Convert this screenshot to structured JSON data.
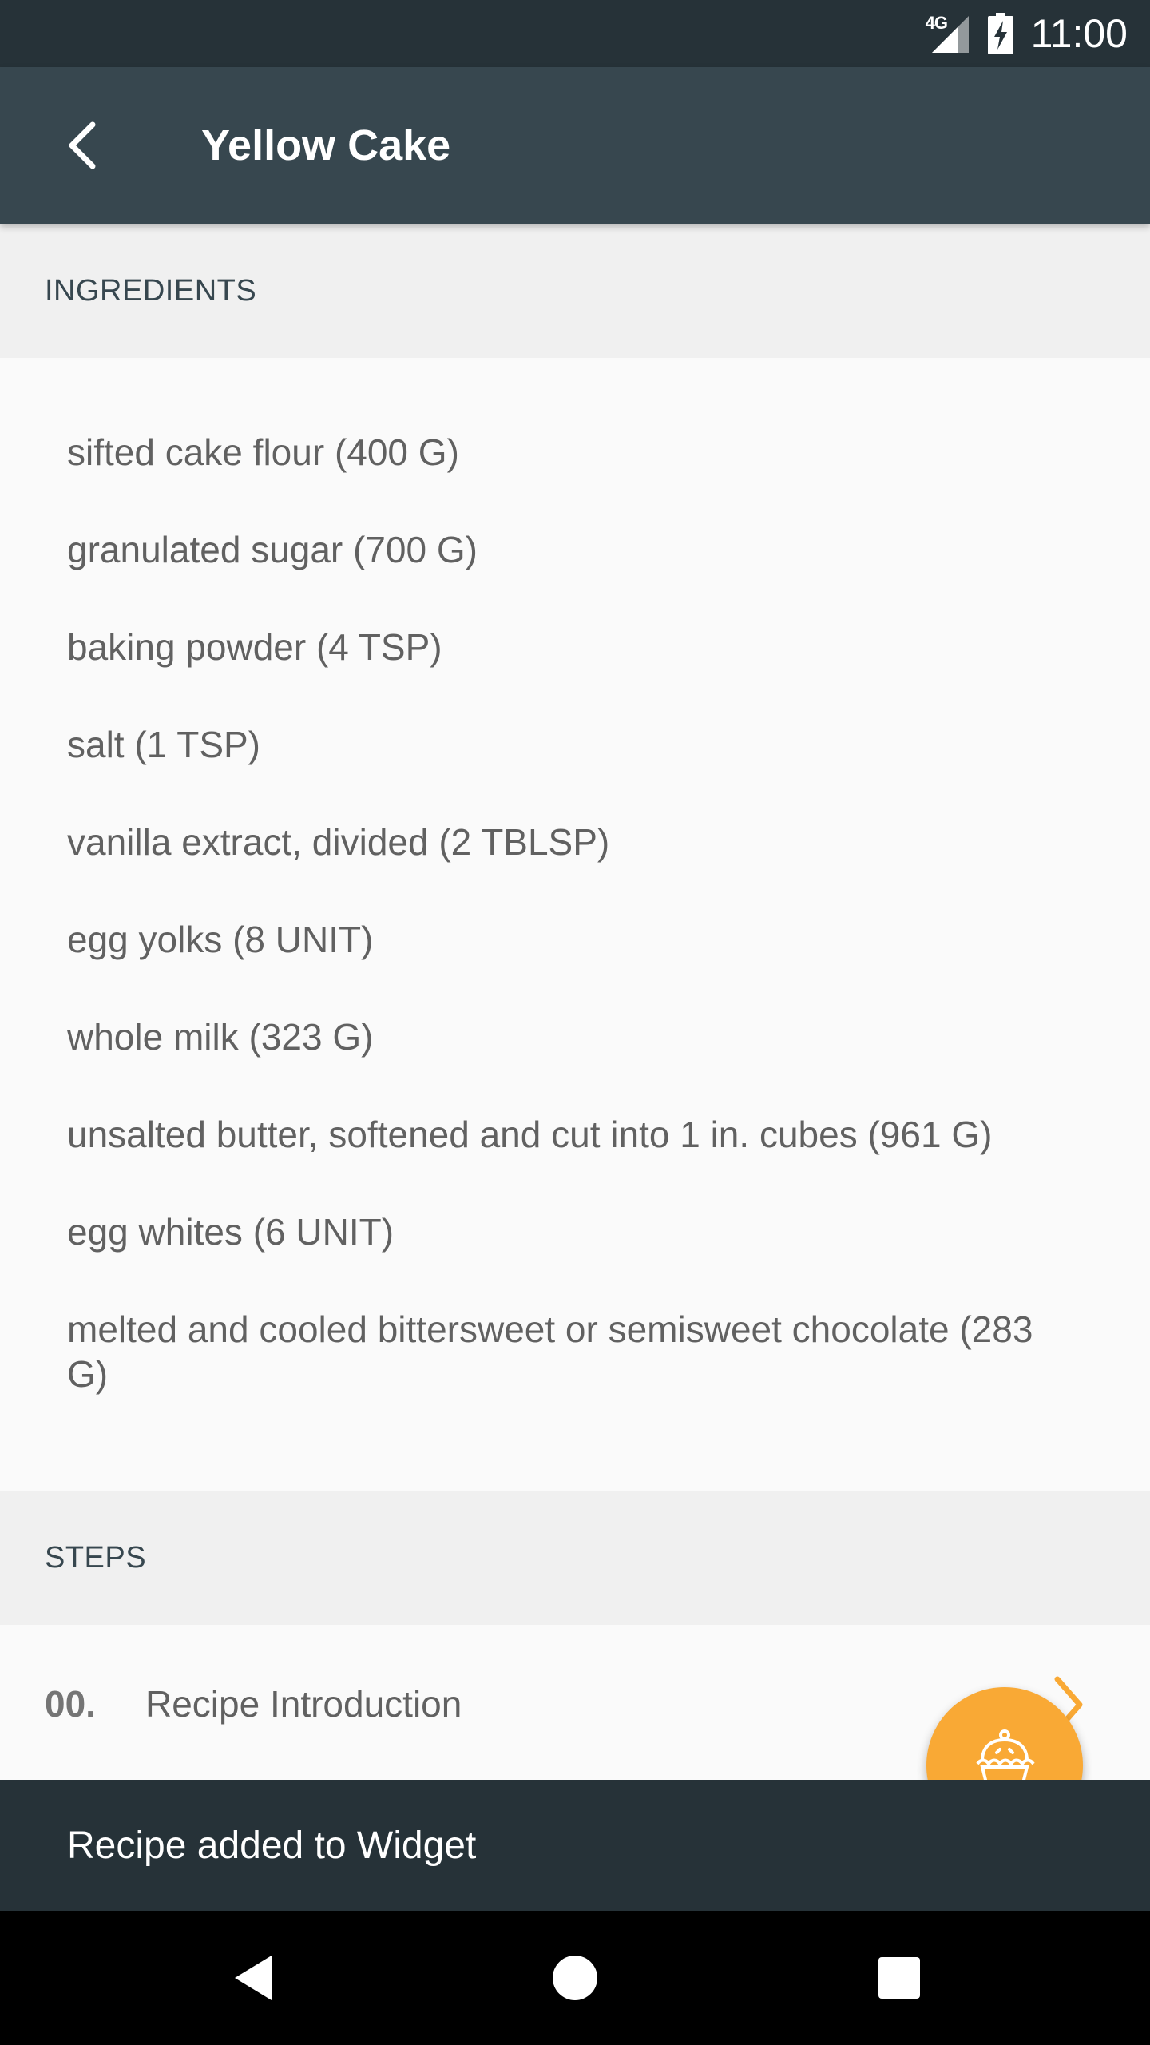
{
  "status_bar": {
    "network": "4G",
    "time": "11:00"
  },
  "app_bar": {
    "title": "Yellow Cake",
    "back_icon": "arrow-back-icon"
  },
  "ingredients": {
    "header": "INGREDIENTS",
    "items": [
      "sifted cake flour (400 G)",
      "granulated sugar (700 G)",
      "baking powder (4 TSP)",
      "salt (1 TSP)",
      "vanilla extract, divided (2 TBLSP)",
      "egg yolks (8 UNIT)",
      "whole milk (323 G)",
      "unsalted butter, softened and cut into 1 in. cubes (961 G)",
      "egg whites (6 UNIT)",
      "melted and cooled bittersweet or semisweet chocolate (283 G)"
    ]
  },
  "steps": {
    "header": "STEPS",
    "items": [
      {
        "number": "00.",
        "label": "Recipe Introduction"
      }
    ]
  },
  "fab": {
    "icon": "cupcake-icon",
    "color": "#f9a935"
  },
  "snackbar": {
    "message": "Recipe added to Widget"
  },
  "nav_bar": {
    "icons": [
      "nav-back-icon",
      "nav-home-icon",
      "nav-recents-icon"
    ]
  },
  "colors": {
    "app_bar": "#37474f",
    "status_bar": "#263238",
    "accent": "#f9a935",
    "section_header_bg": "#f0f0f0"
  }
}
